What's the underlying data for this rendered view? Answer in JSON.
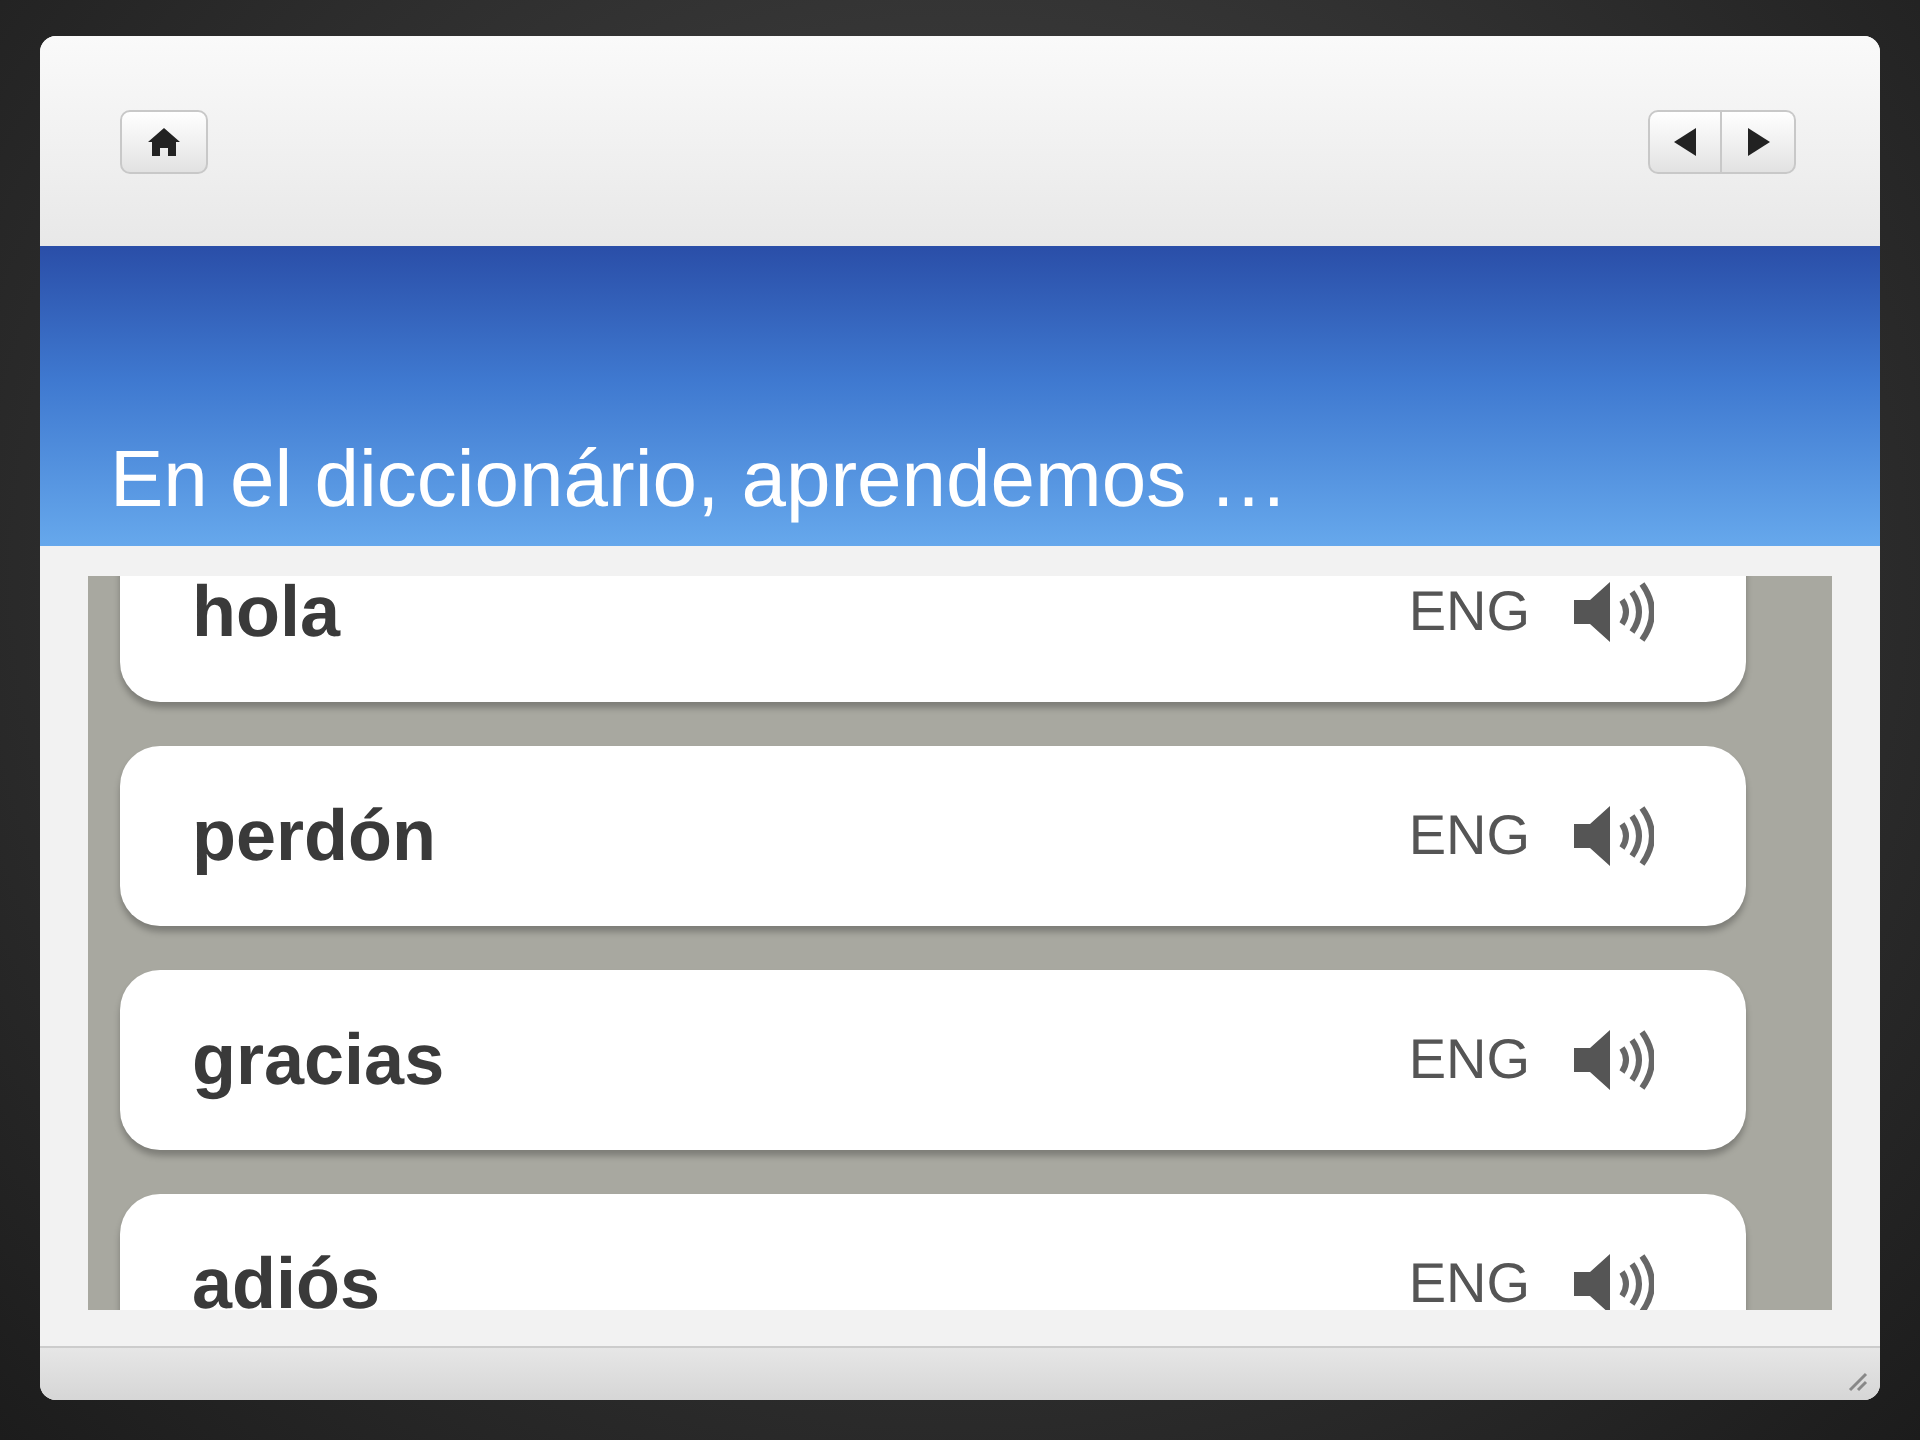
{
  "title": "En el diccionário, aprendemos …",
  "words": [
    {
      "word": "hola",
      "lang": "ENG"
    },
    {
      "word": "perdón",
      "lang": "ENG"
    },
    {
      "word": "gracias",
      "lang": "ENG"
    },
    {
      "word": "adiós",
      "lang": "ENG"
    }
  ]
}
